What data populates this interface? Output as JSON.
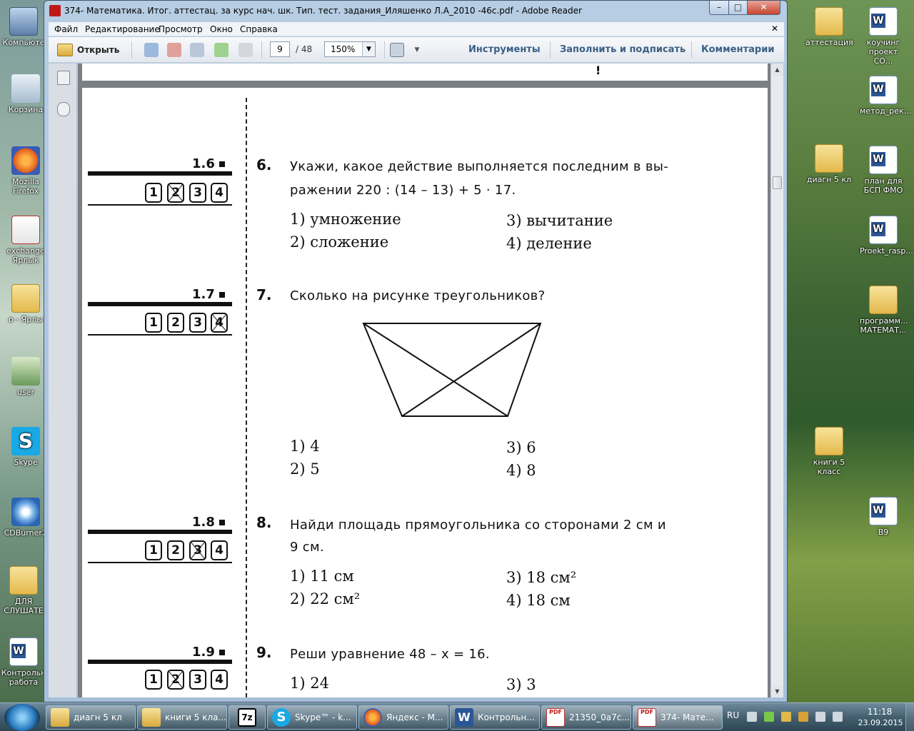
{
  "desktop_left": [
    {
      "label": "Компьюте",
      "icon": "computer-icon"
    },
    {
      "label": "Корзина",
      "icon": "recycle-bin-icon"
    },
    {
      "label": "Mozilla Firefox",
      "icon": "firefox-icon"
    },
    {
      "label": "exchange Ярлык",
      "icon": "shortcut-icon"
    },
    {
      "label": "о - Ярлы",
      "icon": "folder-icon"
    },
    {
      "label": "user",
      "icon": "user-folder-icon"
    },
    {
      "label": "Skype",
      "icon": "skype-icon"
    },
    {
      "label": "CDBurnerX",
      "icon": "cdburner-icon"
    },
    {
      "label": "ДЛЯ СЛУШАТЕ",
      "icon": "folder-icon"
    },
    {
      "label": "Контрольн работа",
      "icon": "word-doc-icon"
    }
  ],
  "desktop_right": [
    {
      "label": "аттестация",
      "icon": "folder-icon"
    },
    {
      "label": "коучинг проект СО...",
      "icon": "word-doc-icon"
    },
    {
      "label": "метод_рек...",
      "icon": "word-doc-icon"
    },
    {
      "label": "диагн 5 кл",
      "icon": "folder-icon"
    },
    {
      "label": "план для БСП ФМО",
      "icon": "word-doc-icon"
    },
    {
      "label": "Proekt_rasp...",
      "icon": "word-doc-icon"
    },
    {
      "label": "программ... МАТЕМАТ...",
      "icon": "folder-icon"
    },
    {
      "label": "книги 5 класс",
      "icon": "folder-icon"
    },
    {
      "label": "В9",
      "icon": "word-doc-icon"
    }
  ],
  "window": {
    "title": "374- Математика. Итог. аттестац. за курс нач. шк. Тип. тест. задания_Иляшенко Л.А_2010 -46с.pdf - Adobe Reader",
    "minimize": "–",
    "maximize": "□",
    "close": "✕"
  },
  "menu": {
    "items": [
      "Файл",
      "Редактирование",
      "Просмотр",
      "Окно",
      "Справка"
    ],
    "close": "✕"
  },
  "toolbar": {
    "open_label": "Открыть",
    "page_current": "9",
    "page_total": "/ 48",
    "zoom": "150%",
    "tools": "Инструменты",
    "fill_sign": "Заполнить и подписать",
    "comments": "Комментарии"
  },
  "document": {
    "top_mark": "!",
    "questions": [
      {
        "num": "6.",
        "answer_label": "1.6",
        "answer_boxes": [
          "1",
          "2",
          "3",
          "4"
        ],
        "crossed": 1,
        "lines": [
          "Укажи, какое действие выполняется последним в вы-",
          "ражении 220 : (14 – 13) + 5 · 17."
        ],
        "options": [
          "1) умножение",
          "2) сложение",
          "3) вычитание",
          "4) деление"
        ]
      },
      {
        "num": "7.",
        "answer_label": "1.7",
        "answer_boxes": [
          "1",
          "2",
          "3",
          "4"
        ],
        "crossed": 3,
        "lines": [
          "Сколько на рисунке треугольников?"
        ],
        "options": [
          "1) 4",
          "2) 5",
          "3) 6",
          "4) 8"
        ]
      },
      {
        "num": "8.",
        "answer_label": "1.8",
        "answer_boxes": [
          "1",
          "2",
          "3",
          "4"
        ],
        "crossed": 2,
        "lines": [
          "Найди площадь прямоугольника со сторонами 2 см и",
          "9 см."
        ],
        "options": [
          "1) 11 см",
          "2) 22 см²",
          "3) 18 см²",
          "4) 18 см"
        ]
      },
      {
        "num": "9.",
        "answer_label": "1.9",
        "answer_boxes": [
          "1",
          "2",
          "3",
          "4"
        ],
        "crossed": 1,
        "lines": [
          "Реши уравнение 48 – x = 16."
        ],
        "options": [
          "1) 24",
          "3) 3"
        ]
      }
    ]
  },
  "taskbar": {
    "items": [
      {
        "label": "диагн 5 кл",
        "icon": "folder-icon"
      },
      {
        "label": "книги 5 кла...",
        "icon": "folder-icon"
      },
      {
        "label": "",
        "icon": "7zip-icon"
      },
      {
        "label": "Skype™ - k...",
        "icon": "skype-icon"
      },
      {
        "label": "Яндекс - М...",
        "icon": "firefox-icon"
      },
      {
        "label": "Контрольн...",
        "icon": "word-icon"
      },
      {
        "label": "21350_0a7c...",
        "icon": "pdf-icon"
      },
      {
        "label": "374- Мате...",
        "icon": "pdf-icon"
      }
    ],
    "lang": "RU",
    "time": "11:18",
    "date": "23.09.2015"
  }
}
